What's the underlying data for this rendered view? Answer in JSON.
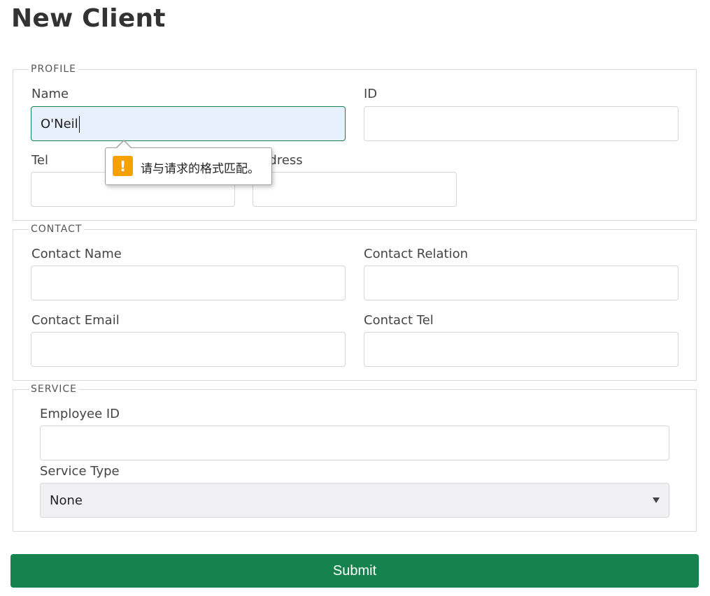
{
  "page": {
    "title": "New Client"
  },
  "profile": {
    "legend": "PROFILE",
    "name_label": "Name",
    "name_value": "O'Neil",
    "id_label": "ID",
    "id_value": "",
    "tel_label": "Tel",
    "tel_value": "",
    "address_label": "Address",
    "address_value": ""
  },
  "contact": {
    "legend": "CONTACT",
    "name_label": "Contact Name",
    "relation_label": "Contact Relation",
    "email_label": "Contact Email",
    "tel_label": "Contact Tel"
  },
  "service": {
    "legend": "SERVICE",
    "employee_label": "Employee ID",
    "type_label": "Service Type",
    "type_selected": "None"
  },
  "validation_tooltip": {
    "icon": "warning-icon",
    "icon_glyph": "!",
    "message": "请与请求的格式匹配。",
    "icon_color": "#f5a100"
  },
  "submit": {
    "label": "Submit",
    "color": "#16834f"
  }
}
